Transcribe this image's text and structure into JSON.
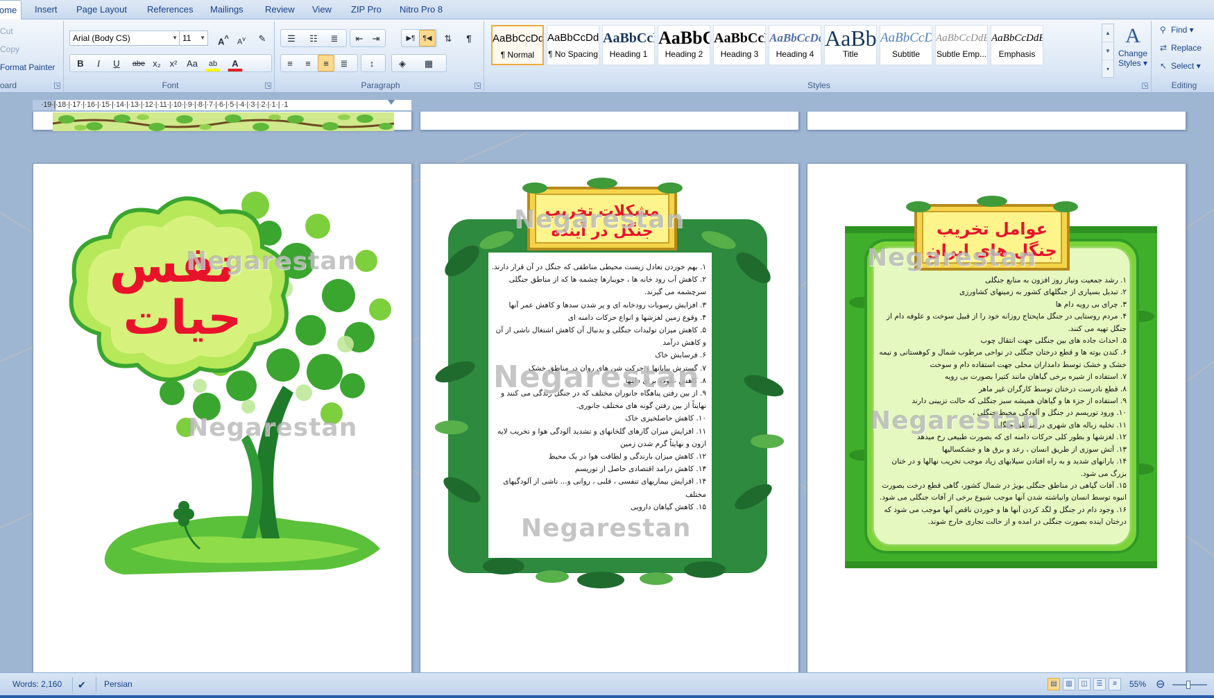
{
  "tabs": [
    {
      "label": "ome",
      "active": true
    },
    {
      "label": "Insert"
    },
    {
      "label": "Page Layout"
    },
    {
      "label": "References"
    },
    {
      "label": "Mailings"
    },
    {
      "label": "Review"
    },
    {
      "label": "View"
    },
    {
      "label": "ZIP Pro"
    },
    {
      "label": "Nitro Pro 8"
    }
  ],
  "clipboard": {
    "cut": "Cut",
    "copy": "Copy",
    "format_painter": "Format Painter",
    "label": "oard"
  },
  "font": {
    "name": "Arial (Body CS)",
    "size": "11",
    "label": "Font",
    "bold": "B",
    "italic": "I",
    "underline": "U",
    "strike": "abe",
    "subscript": "x₂",
    "superscript": "x²",
    "change_case": "Aa",
    "grow": "A",
    "shrink": "A",
    "highlight": "ab",
    "font_color": "A",
    "highlight_color": "#ffff00",
    "font_color_value": "#e02020"
  },
  "paragraph": {
    "label": "Paragraph"
  },
  "styles": {
    "label": "Styles",
    "items": [
      {
        "sample": "AaBbCcDdEe",
        "name": "¶ Normal",
        "selected": true
      },
      {
        "sample": "AaBbCcDdEe",
        "name": "¶ No Spacing"
      },
      {
        "sample": "AaBbCcDdEe",
        "name": "Heading 1"
      },
      {
        "sample": "AaBbCcDdEe",
        "name": "Heading 2"
      },
      {
        "sample": "AaBbCcDdEe",
        "name": "Heading 3"
      },
      {
        "sample": "AaBbCcDdEe",
        "name": "Heading 4"
      },
      {
        "sample": "AaBbCcDdEe",
        "name": "Title"
      },
      {
        "sample": "AaBbCcDdEe",
        "name": "Subtitle"
      },
      {
        "sample": "AaBbCcDdEe",
        "name": "Subtle Emp..."
      },
      {
        "sample": "AaBbCcDdEe",
        "name": "Emphasis"
      }
    ],
    "change_styles_line1": "Change",
    "change_styles_line2": "Styles"
  },
  "editing": {
    "label": "Editing",
    "find": "Find",
    "replace": "Replace",
    "select": "Select"
  },
  "ruler": {
    "text": "·19·|·18·|·17·|·16·|·15·|·14·|·13·|·12·|·11·|·10·|·9·|·8·|·7·|·6·|·5·|·4·|·3·|·2·|·1·|  ·1"
  },
  "pages": {
    "watermark": "Negarestan",
    "cover": {
      "line1": "نفس",
      "line2": "حیات"
    },
    "middle": {
      "title_line1": "مشکلات تخریب",
      "title_line2": "جنگل در آینده",
      "items": [
        "۱. بهم خوردن تعادل زیست محیطی مناطقی که جنگل در آن قرار دارند.",
        "۲. کاهش آب رود خانه ها ، جویبارها چشمه ها که از مناطق جنگلی سرچشمه می گیرند.",
        "۳. افزایش رسوبات رودخانه ای و پر شدن سدها و کاهش عمر آنها",
        "۴. وقوع زمین لغزشها و انواع حرکات دامنه ای",
        "۵. کاهش میزان تولیدات جنگلی و بدنبال آن کاهش اشتغال ناشی از آن و کاهش درآمد",
        "۶. فرسایش خاک",
        "۷. گسترش بیابانها و حرکت شن های روان در مناطق خشک",
        "۸. کاهش علوفه برای دامها",
        "۹. از بین رفتن پناهگاه جانوران مختلف که در جنگل زندگی می کنند و نهایتاً از بین رفتن گونه های مختلف جانوری.",
        "۱۰. کاهش حاصلخیزی خاک",
        "۱۱. افزایش میزان گازهای گلخانهای و تشدید آلودگی هوا و تخریب لایه ازون و نهایتاً گرم شدن زمین",
        "۱۲. کاهش میزان بارندگی و لطافت هوا در یک محیط",
        "۱۳. کاهش درامد اقتصادی حاصل از توریسم",
        "۱۴. افزایش بیماریهای تنفسی ، قلبی ، روانی و... ناشی از آلودگیهای مختلف",
        "۱۵. کاهش گیاهان دارویی"
      ]
    },
    "right": {
      "title_line1": "عوامل تخریب",
      "title_line2": "جنگل های ایران",
      "items": [
        "۱. رشد جمعیت ونیاز روز افزون به منابع جنگلی",
        "۲. تبدیل بسیاری از جنگلهای کشور به زمینهای کشاورزی",
        "۳. چرای بی رویه دام ها",
        "۴. مردم روستایی در جنگل ماپحتاج روزانه خود را از قبیل سوخت و علوفه دام از جنگل تهیه می کنند.",
        "۵. احداث جاده های بین جنگلی جهت انتقال چوب",
        "۶. کندن بوته ها و قطع درختان جنگلی در نواحی مرطوب شمال و کوهستانی و نیمه خشک و خشک توسط دامداران محلی جهت استفاده دام و سوخت",
        "۷. استفاده از شیره برخی گیاهان مانند کتیرا بصورت بی رویه",
        "۸. قطع نادرست درختان توسط کارگران غیر ماهر",
        "۹. استفاده از جزء ها و گیاهان همیشه سبز جنگلی که حالت تزیینی دارند",
        "۱۰. ورود توریسم در جنگل و آلودگی محیط جنگلی ،",
        "۱۱. تخلیه زباله های شهری در مناطق جنگلی",
        "۱۲. لغزشها و بطور کلی حرکات دامنه ای که بصورت طبیعی رخ میدهد",
        "۱۳. آتش سوزی از طریق انسان ، رعد و برق ها و خشکسالیها",
        "۱۴. بارانهای شدید و به راه افتادن سیلابهای زیاد موجب تخریب نهالها و در ختان بزرگ می شود.",
        "۱۵. آفات گیاهی در مناطق جنگلی بویژ در شمال کشور، گاهی قطع درخت بصورت انبوه توسط انسان وانباشته شدن آنها موجب شیوع برخی از آفات جنگلی می شود.",
        "۱۶. وجود دام در جنگل و لگد کردن آنها ها و خوردن ناقص آنها موجب می شود که درختان اینده بصورت جنگلی در امده و از حالت تجاری خارج شوند."
      ]
    }
  },
  "status": {
    "words": "Words: 2,160",
    "language": "Persian",
    "zoom": "55%",
    "zoom_fraction": 0.45
  },
  "colors": {
    "accent": "#2b5797",
    "title_red": "#e8132b",
    "banner_yellow": "#fdf48c",
    "leaf_green": "#3aa52f",
    "light_green": "#c8f08a"
  },
  "icons": [
    "paste-icon",
    "scissors-icon",
    "copy-icon",
    "brush-icon",
    "bullets-icon",
    "numbering-icon",
    "multilevel-list-icon",
    "decrease-indent-icon",
    "increase-indent-icon",
    "ltr-icon",
    "rtl-icon",
    "sort-icon",
    "pilcrow-icon",
    "align-left-icon",
    "align-center-icon",
    "align-right-icon",
    "justify-icon",
    "line-spacing-icon",
    "shading-icon",
    "borders-icon",
    "binoculars-icon",
    "replace-icon",
    "cursor-icon",
    "spellcheck-icon",
    "zoom-out-icon"
  ]
}
